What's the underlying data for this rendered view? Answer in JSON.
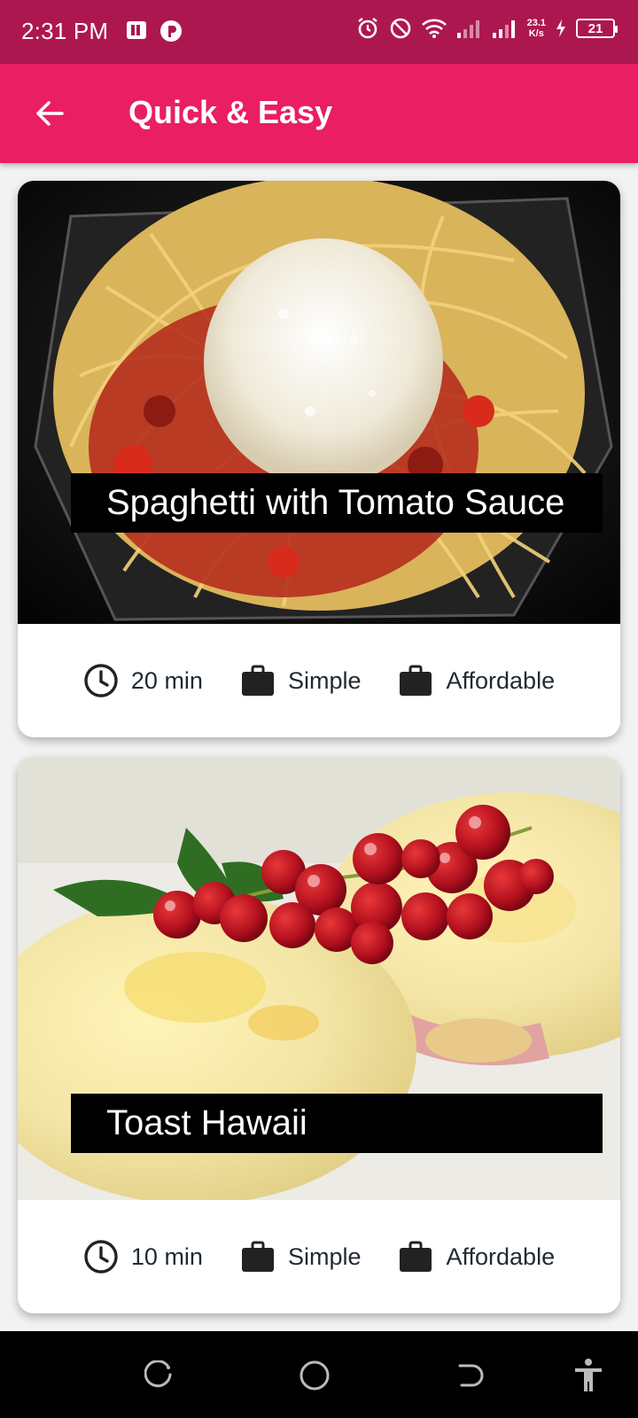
{
  "status_bar": {
    "time": "2:31 PM",
    "net_speed_value": "23.1",
    "net_speed_unit": "K/s",
    "battery": "21"
  },
  "app_bar": {
    "title": "Quick & Easy"
  },
  "meals": [
    {
      "title": "Spaghetti with Tomato Sauce",
      "duration": "20 min",
      "complexity": "Simple",
      "affordability": "Affordable"
    },
    {
      "title": "Toast Hawaii",
      "duration": "10 min",
      "complexity": "Simple",
      "affordability": "Affordable"
    }
  ],
  "colors": {
    "status_bar": "#ad1750",
    "app_bar": "#e91e63",
    "title_box": "#000000",
    "meta_text": "#1f2a33"
  }
}
